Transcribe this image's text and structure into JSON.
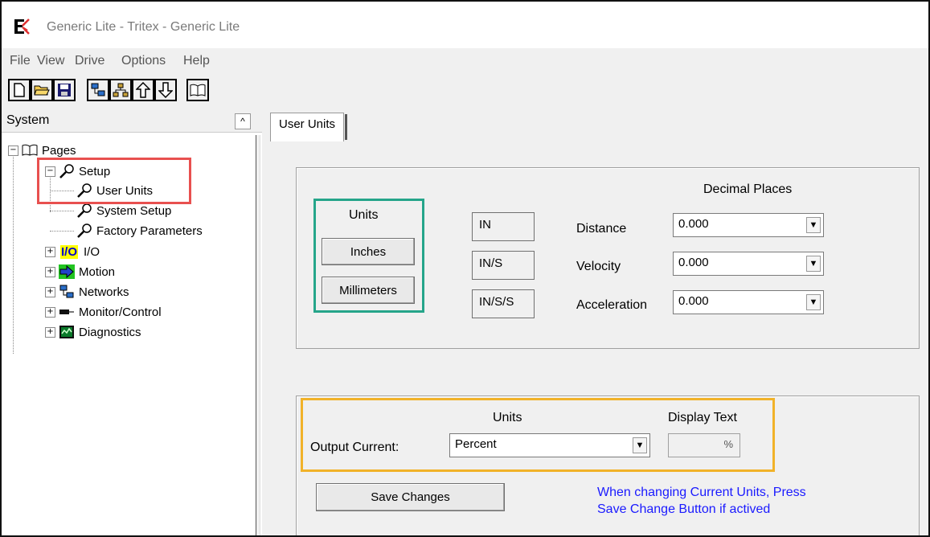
{
  "window": {
    "title": "Generic Lite - Tritex - Generic Lite"
  },
  "menu": {
    "items": [
      "File",
      "View",
      "Drive",
      "Options",
      "Help"
    ]
  },
  "toolbar": {
    "buttons": [
      "new-file-icon",
      "open-folder-icon",
      "save-icon",
      "network-icon",
      "hierarchy-icon",
      "upload-arrow-icon",
      "download-arrow-icon",
      "book-icon"
    ]
  },
  "sidebar": {
    "title": "System",
    "collapse": "^",
    "tree": {
      "pages": "Pages",
      "setup": "Setup",
      "user_units": "User Units",
      "system_setup": "System Setup",
      "factory_parameters": "Factory Parameters",
      "io": "I/O",
      "io_badge": "I/O",
      "motion": "Motion",
      "networks": "Networks",
      "monitor_control": "Monitor/Control",
      "diagnostics": "Diagnostics"
    }
  },
  "tab": {
    "label": "User Units"
  },
  "units_panel": {
    "units_header": "Units",
    "inches_button": "Inches",
    "millimeters_button": "Millimeters",
    "decimal_header": "Decimal Places",
    "rows": [
      {
        "unit": "IN",
        "label": "Distance",
        "value": "0.000"
      },
      {
        "unit": "IN/S",
        "label": "Velocity",
        "value": "0.000"
      },
      {
        "unit": "IN/S/S",
        "label": "Acceleration",
        "value": "0.000"
      }
    ]
  },
  "current_panel": {
    "units_header": "Units",
    "display_header": "Display Text",
    "output_label": "Output Current:",
    "output_value": "Percent",
    "display_value": "%",
    "save_button": "Save Changes",
    "note_line1": "When changing Current Units, Press",
    "note_line2": "Save Change Button if actived"
  },
  "highlight_colors": {
    "red": "#e8504f",
    "teal": "#25a58a",
    "orange": "#f1b229"
  }
}
